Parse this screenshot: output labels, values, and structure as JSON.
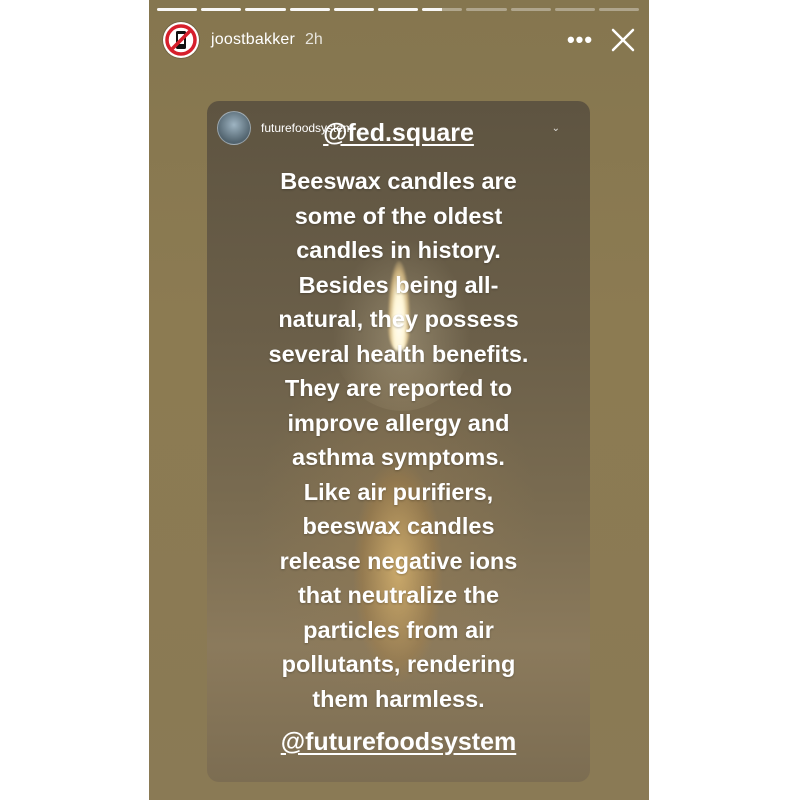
{
  "story": {
    "username": "joostbakker",
    "time_ago": "2h",
    "progress": {
      "total_segments": 11,
      "completed": 6,
      "current_fraction": 0.5
    },
    "icons": {
      "more": "more-horizontal-icon",
      "close": "close-icon"
    },
    "more_glyph": "•••"
  },
  "shared_post": {
    "username": "futurefoodsystem",
    "mention_top": "@fed.square",
    "text_lines": [
      "Beeswax candles are",
      "some of the oldest",
      "candles in history.",
      "Besides being all-",
      "natural, they possess",
      "several health benefits.",
      "They are reported to",
      "improve allergy and",
      "asthma symptoms.",
      "Like air purifiers,",
      "beeswax candles",
      "release negative ions",
      "that neutralize the",
      "particles from air",
      "pollutants, rendering",
      "them harmless."
    ],
    "mention_bottom": "@futurefoodsystem"
  }
}
